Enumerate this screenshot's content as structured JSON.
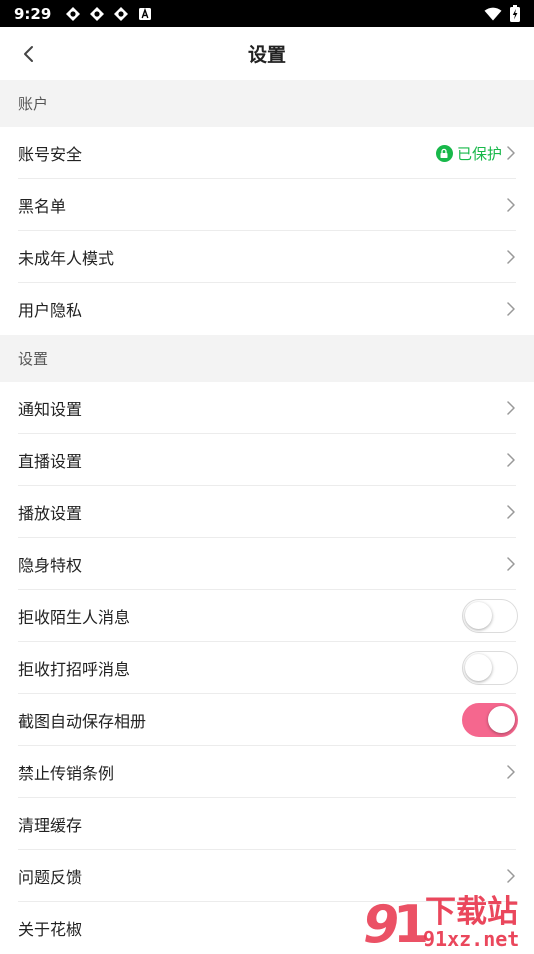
{
  "status_bar": {
    "time": "9:29",
    "notification_icons": [
      "app-icon-1",
      "app-icon-2",
      "app-icon-3",
      "a-box-icon"
    ],
    "right_icons": [
      "wifi-icon",
      "battery-charging-icon"
    ]
  },
  "nav": {
    "title": "设置",
    "back_icon": "chevron-left-icon"
  },
  "sections": {
    "account": {
      "header": "账户",
      "items": [
        {
          "label": "账号安全",
          "status": "已保护"
        },
        {
          "label": "黑名单"
        },
        {
          "label": "未成年人模式"
        },
        {
          "label": "用户隐私"
        }
      ]
    },
    "settings": {
      "header": "设置",
      "items": [
        {
          "label": "通知设置"
        },
        {
          "label": "直播设置"
        },
        {
          "label": "播放设置"
        },
        {
          "label": "隐身特权"
        },
        {
          "label": "拒收陌生人消息",
          "toggle": false
        },
        {
          "label": "拒收打招呼消息",
          "toggle": false
        },
        {
          "label": "截图自动保存相册",
          "toggle": true
        },
        {
          "label": "禁止传销条例"
        },
        {
          "label": "清理缓存"
        },
        {
          "label": "问题反馈"
        },
        {
          "label": "关于花椒"
        }
      ]
    }
  },
  "colors": {
    "accent_toggle": "#f5678e",
    "protected_green": "#18b84a",
    "section_bg": "#f3f3f3"
  },
  "watermark": {
    "brand_text": "下载站",
    "domain_text": "91xz.net"
  }
}
